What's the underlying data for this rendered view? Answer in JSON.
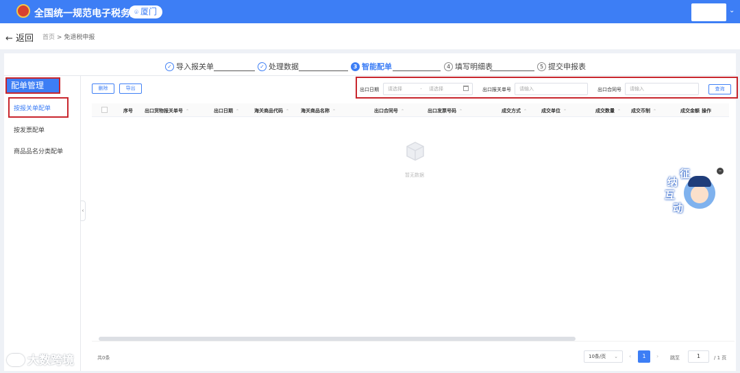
{
  "header": {
    "app_title": "全国统一规范电子税务局",
    "region": "厦门"
  },
  "breadcrumb": {
    "back_label": "返回",
    "home": "首页",
    "separator": ">",
    "current": "免退税申报"
  },
  "steps": [
    {
      "num": "✓",
      "label": "导入报关单",
      "state": "done"
    },
    {
      "num": "✓",
      "label": "处理数据",
      "state": "done"
    },
    {
      "num": "3",
      "label": "智能配单",
      "state": "active"
    },
    {
      "num": "4",
      "label": "填写明细表",
      "state": "todo"
    },
    {
      "num": "5",
      "label": "提交申报表",
      "state": "todo"
    }
  ],
  "sidebar": {
    "title": "配单管理",
    "items": [
      {
        "label": "按报关单配单",
        "active": true
      },
      {
        "label": "按发票配单",
        "active": false
      },
      {
        "label": "商品品名分类配单",
        "active": false
      }
    ]
  },
  "toolbar": {
    "delete_label": "删除",
    "export_label": "导出"
  },
  "filters": {
    "export_date_label": "出口日期",
    "date_start_placeholder": "请选择",
    "date_sep": "-",
    "date_end_placeholder": "请选择",
    "declaration_no_label": "出口报关单号",
    "declaration_no_placeholder": "请输入",
    "contract_no_label": "出口合同号",
    "contract_no_placeholder": "请输入",
    "query_label": "查询"
  },
  "table": {
    "columns": [
      "序号",
      "出口货物报关单号",
      "出口日期",
      "海关商品代码",
      "海关商品名称",
      "出口合同号",
      "出口发票号码",
      "成交方式",
      "成交单位",
      "成交数量",
      "成交币制",
      "成交金额",
      "操作"
    ],
    "sort_symbol": "⌃",
    "empty_text": "暂无数据"
  },
  "pagination": {
    "total_text": "共0条",
    "page_size": "10条/页",
    "current_page": "1",
    "goto_label": "跳至",
    "goto_value": "1",
    "total_pages": "/ 1 页"
  },
  "mascot": {
    "chars": [
      "征",
      "纳",
      "互",
      "动"
    ]
  },
  "watermark": {
    "text": "大数跨境"
  },
  "colors": {
    "primary": "#3d7ef5",
    "highlight_border": "#c8242b"
  }
}
